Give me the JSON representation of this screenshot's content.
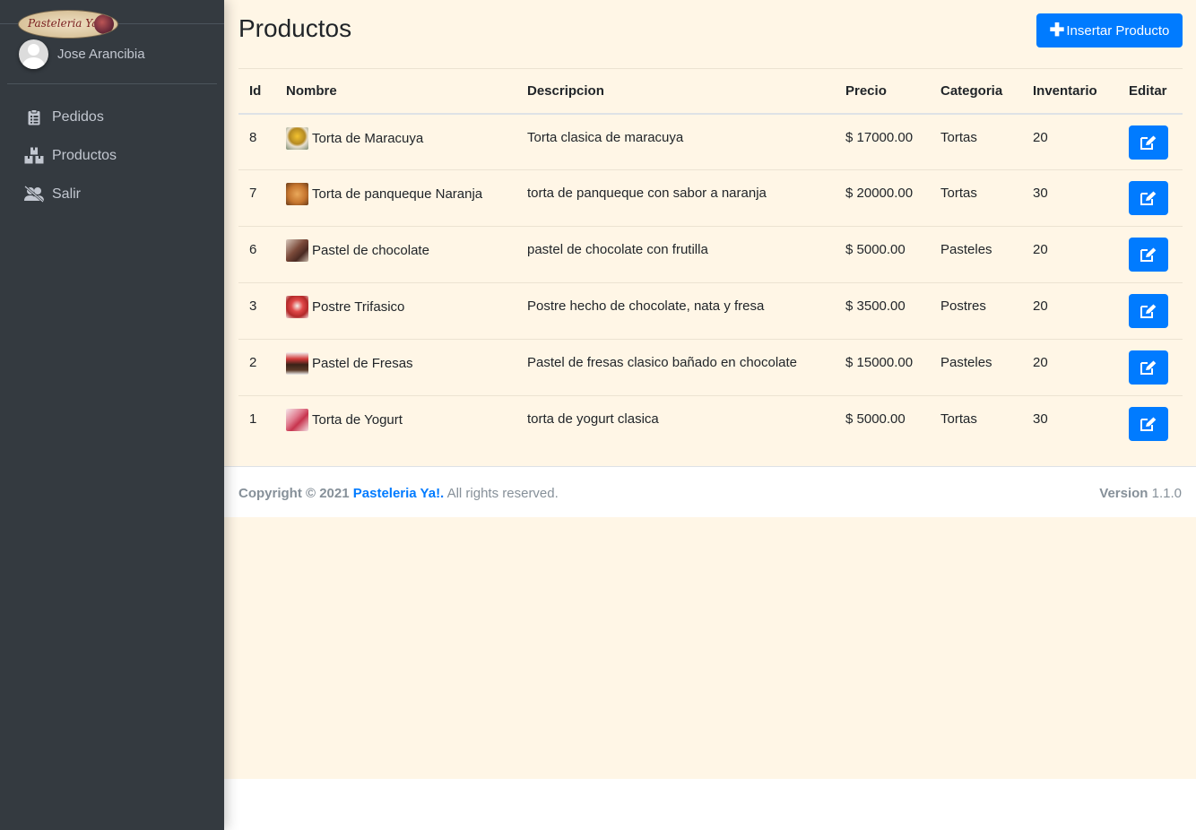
{
  "sidebar": {
    "brand_text": "Pasteleria Ya!",
    "user_name": "Jose Arancibia",
    "items": [
      {
        "label": "Pedidos",
        "icon": "clipboard-icon"
      },
      {
        "label": "Productos",
        "icon": "boxes-icon"
      },
      {
        "label": "Salir",
        "icon": "user-slash-icon"
      }
    ]
  },
  "main": {
    "title": "Productos",
    "insert_button": "Insertar Producto",
    "table": {
      "headers": [
        "Id",
        "Nombre",
        "Descripcion",
        "Precio",
        "Categoria",
        "Inventario",
        "Editar"
      ],
      "rows": [
        {
          "id": "8",
          "name": "Torta de Maracuya",
          "description": "Torta clasica de maracuya",
          "price": "$ 17000.00",
          "category": "Tortas",
          "stock": "20"
        },
        {
          "id": "7",
          "name": "Torta de panqueque Naranja",
          "description": "torta de panqueque con sabor a naranja",
          "price": "$ 20000.00",
          "category": "Tortas",
          "stock": "30"
        },
        {
          "id": "6",
          "name": "Pastel de chocolate",
          "description": "pastel de chocolate con frutilla",
          "price": "$ 5000.00",
          "category": "Pasteles",
          "stock": "20"
        },
        {
          "id": "3",
          "name": "Postre Trifasico",
          "description": "Postre hecho de chocolate, nata y fresa",
          "price": "$ 3500.00",
          "category": "Postres",
          "stock": "20"
        },
        {
          "id": "2",
          "name": "Pastel de Fresas",
          "description": "Pastel de fresas clasico bañado en chocolate",
          "price": "$ 15000.00",
          "category": "Pasteles",
          "stock": "20"
        },
        {
          "id": "1",
          "name": "Torta de Yogurt",
          "description": "torta de yogurt clasica",
          "price": "$ 5000.00",
          "category": "Tortas",
          "stock": "30"
        }
      ]
    }
  },
  "footer": {
    "copyright": "Copyright © 2021",
    "brand": "Pasteleria Ya!.",
    "rights": " All rights reserved.",
    "version_label": "Version",
    "version": " 1.1.0"
  },
  "colors": {
    "sidebar_bg": "#343a40",
    "content_bg": "#fff6e6",
    "primary": "#007bff"
  }
}
